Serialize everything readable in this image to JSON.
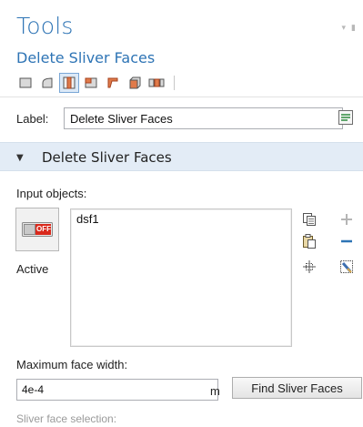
{
  "header": {
    "title": "Tools",
    "controls": [
      "pin-icon-arrow",
      "pin-icon"
    ]
  },
  "feature": {
    "name": "Delete Sliver Faces"
  },
  "toolbar": {
    "icons": [
      "face-select-icon",
      "curved-face-icon",
      "sliver-face-icon",
      "split-face-icon",
      "angled-face-icon",
      "box-face-icon",
      "multi-face-icon"
    ],
    "active_index": 2
  },
  "label_field": {
    "label": "Label:",
    "value": "Delete Sliver Faces",
    "button_icon": "label-edit-icon"
  },
  "section": {
    "title": "Delete Sliver Faces",
    "expanded": true
  },
  "input_objects": {
    "label": "Input objects:",
    "toggle_state_text": "OFF",
    "toggle_label": "Active",
    "items": [
      "dsf1"
    ],
    "side_icons": [
      "copy-icon",
      "add-icon",
      "paste-icon",
      "remove-icon",
      "zoom-selection-icon",
      "clear-selection-icon"
    ]
  },
  "max_face_width": {
    "label": "Maximum face width:",
    "value": "4e-4",
    "unit": "m",
    "button_label": "Find Sliver Faces"
  },
  "sliver_selection": {
    "label": "Sliver face selection:"
  },
  "colors": {
    "title_blue": "#2e74b5",
    "section_bg": "#e3ecf6",
    "toggle_red": "#d9291c"
  }
}
